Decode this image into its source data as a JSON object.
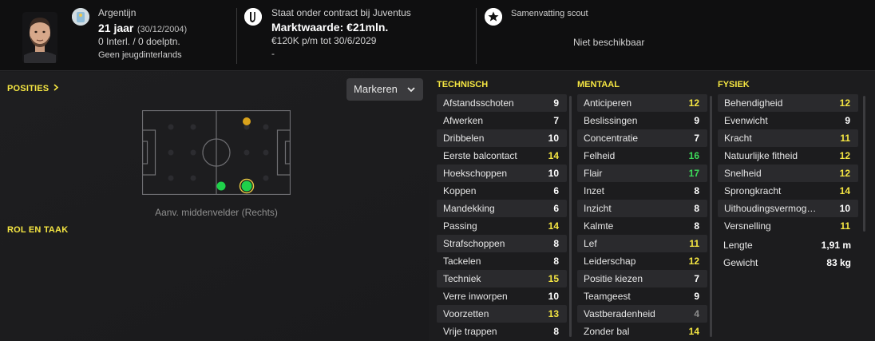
{
  "header": {
    "nationality": "Argentijn",
    "age": "21 jaar",
    "birthdate": "(30/12/2004)",
    "caps": "0 Interl. / 0 doelptn.",
    "youth": "Geen jeugdinterlands",
    "contract": "Staat onder contract bij Juventus",
    "value": "Marktwaarde: €21mln.",
    "wage": "€120K p/m tot 30/6/2029",
    "dash": "-",
    "scout_title": "Samenvatting scout",
    "scout_status": "Niet beschikbaar"
  },
  "left": {
    "positions_title": "POSITIES",
    "role_title": "ROL EN TAAK",
    "dropdown_label": "Markeren",
    "position_label": "Aanv. middenvelder (Rechts)"
  },
  "colors": {
    "accent": "#f5e642",
    "white_value": "#ffffff",
    "yellow_value": "#f5e642",
    "green_value": "#3ddc5a",
    "gray_value": "#8e8e8e",
    "pitch_dot_orange": "#d9a21b",
    "pitch_dot_green": "#1fd14a"
  },
  "technical": {
    "title": "TECHNISCH",
    "items": [
      {
        "name": "Afstandsschoten",
        "value": "9",
        "tone": "white"
      },
      {
        "name": "Afwerken",
        "value": "7",
        "tone": "white"
      },
      {
        "name": "Dribbelen",
        "value": "10",
        "tone": "white"
      },
      {
        "name": "Eerste balcontact",
        "value": "14",
        "tone": "yellow"
      },
      {
        "name": "Hoekschoppen",
        "value": "10",
        "tone": "white"
      },
      {
        "name": "Koppen",
        "value": "6",
        "tone": "white"
      },
      {
        "name": "Mandekking",
        "value": "6",
        "tone": "white"
      },
      {
        "name": "Passing",
        "value": "14",
        "tone": "yellow"
      },
      {
        "name": "Strafschoppen",
        "value": "8",
        "tone": "white"
      },
      {
        "name": "Tackelen",
        "value": "8",
        "tone": "white"
      },
      {
        "name": "Techniek",
        "value": "15",
        "tone": "yellow"
      },
      {
        "name": "Verre inworpen",
        "value": "10",
        "tone": "white"
      },
      {
        "name": "Voorzetten",
        "value": "13",
        "tone": "yellow"
      },
      {
        "name": "Vrije trappen",
        "value": "8",
        "tone": "white"
      }
    ]
  },
  "mental": {
    "title": "MENTAAL",
    "items": [
      {
        "name": "Anticiperen",
        "value": "12",
        "tone": "yellow"
      },
      {
        "name": "Beslissingen",
        "value": "9",
        "tone": "white"
      },
      {
        "name": "Concentratie",
        "value": "7",
        "tone": "white"
      },
      {
        "name": "Felheid",
        "value": "16",
        "tone": "green"
      },
      {
        "name": "Flair",
        "value": "17",
        "tone": "green"
      },
      {
        "name": "Inzet",
        "value": "8",
        "tone": "white"
      },
      {
        "name": "Inzicht",
        "value": "8",
        "tone": "white"
      },
      {
        "name": "Kalmte",
        "value": "8",
        "tone": "white"
      },
      {
        "name": "Lef",
        "value": "11",
        "tone": "yellow"
      },
      {
        "name": "Leiderschap",
        "value": "12",
        "tone": "yellow"
      },
      {
        "name": "Positie kiezen",
        "value": "7",
        "tone": "white"
      },
      {
        "name": "Teamgeest",
        "value": "9",
        "tone": "white"
      },
      {
        "name": "Vastberadenheid",
        "value": "4",
        "tone": "gray"
      },
      {
        "name": "Zonder bal",
        "value": "14",
        "tone": "yellow"
      }
    ]
  },
  "physical": {
    "title": "FYSIEK",
    "items": [
      {
        "name": "Behendigheid",
        "value": "12",
        "tone": "yellow"
      },
      {
        "name": "Evenwicht",
        "value": "9",
        "tone": "white"
      },
      {
        "name": "Kracht",
        "value": "11",
        "tone": "yellow"
      },
      {
        "name": "Natuurlijke fitheid",
        "value": "12",
        "tone": "yellow"
      },
      {
        "name": "Snelheid",
        "value": "12",
        "tone": "yellow"
      },
      {
        "name": "Sprongkracht",
        "value": "14",
        "tone": "yellow"
      },
      {
        "name": "Uithoudingsvermog…",
        "value": "10",
        "tone": "white"
      },
      {
        "name": "Versnelling",
        "value": "11",
        "tone": "yellow"
      }
    ],
    "height_label": "Lengte",
    "height_value": "1,91 m",
    "weight_label": "Gewicht",
    "weight_value": "83 kg"
  }
}
